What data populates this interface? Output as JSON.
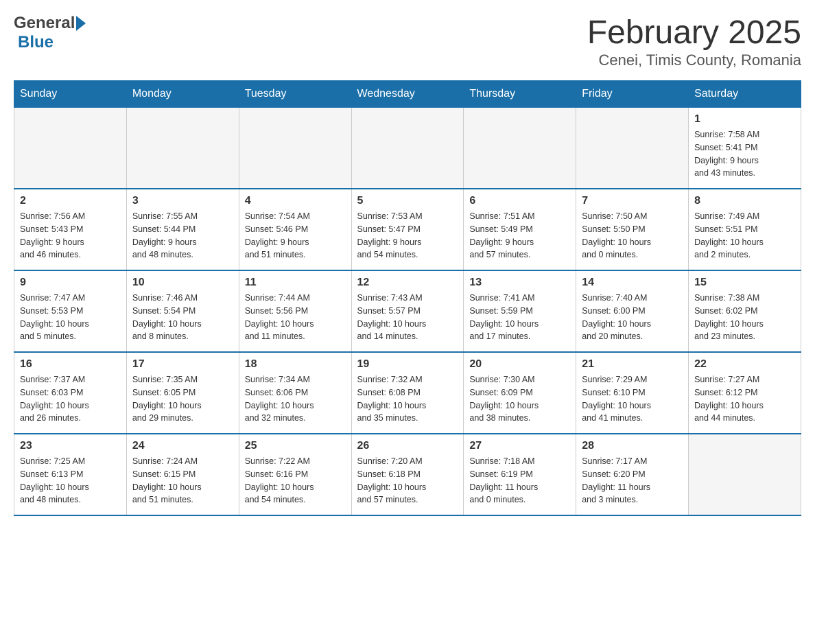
{
  "header": {
    "title": "February 2025",
    "subtitle": "Cenei, Timis County, Romania",
    "logo_general": "General",
    "logo_blue": "Blue"
  },
  "days_of_week": [
    "Sunday",
    "Monday",
    "Tuesday",
    "Wednesday",
    "Thursday",
    "Friday",
    "Saturday"
  ],
  "weeks": [
    [
      {
        "day": "",
        "info": ""
      },
      {
        "day": "",
        "info": ""
      },
      {
        "day": "",
        "info": ""
      },
      {
        "day": "",
        "info": ""
      },
      {
        "day": "",
        "info": ""
      },
      {
        "day": "",
        "info": ""
      },
      {
        "day": "1",
        "info": "Sunrise: 7:58 AM\nSunset: 5:41 PM\nDaylight: 9 hours\nand 43 minutes."
      }
    ],
    [
      {
        "day": "2",
        "info": "Sunrise: 7:56 AM\nSunset: 5:43 PM\nDaylight: 9 hours\nand 46 minutes."
      },
      {
        "day": "3",
        "info": "Sunrise: 7:55 AM\nSunset: 5:44 PM\nDaylight: 9 hours\nand 48 minutes."
      },
      {
        "day": "4",
        "info": "Sunrise: 7:54 AM\nSunset: 5:46 PM\nDaylight: 9 hours\nand 51 minutes."
      },
      {
        "day": "5",
        "info": "Sunrise: 7:53 AM\nSunset: 5:47 PM\nDaylight: 9 hours\nand 54 minutes."
      },
      {
        "day": "6",
        "info": "Sunrise: 7:51 AM\nSunset: 5:49 PM\nDaylight: 9 hours\nand 57 minutes."
      },
      {
        "day": "7",
        "info": "Sunrise: 7:50 AM\nSunset: 5:50 PM\nDaylight: 10 hours\nand 0 minutes."
      },
      {
        "day": "8",
        "info": "Sunrise: 7:49 AM\nSunset: 5:51 PM\nDaylight: 10 hours\nand 2 minutes."
      }
    ],
    [
      {
        "day": "9",
        "info": "Sunrise: 7:47 AM\nSunset: 5:53 PM\nDaylight: 10 hours\nand 5 minutes."
      },
      {
        "day": "10",
        "info": "Sunrise: 7:46 AM\nSunset: 5:54 PM\nDaylight: 10 hours\nand 8 minutes."
      },
      {
        "day": "11",
        "info": "Sunrise: 7:44 AM\nSunset: 5:56 PM\nDaylight: 10 hours\nand 11 minutes."
      },
      {
        "day": "12",
        "info": "Sunrise: 7:43 AM\nSunset: 5:57 PM\nDaylight: 10 hours\nand 14 minutes."
      },
      {
        "day": "13",
        "info": "Sunrise: 7:41 AM\nSunset: 5:59 PM\nDaylight: 10 hours\nand 17 minutes."
      },
      {
        "day": "14",
        "info": "Sunrise: 7:40 AM\nSunset: 6:00 PM\nDaylight: 10 hours\nand 20 minutes."
      },
      {
        "day": "15",
        "info": "Sunrise: 7:38 AM\nSunset: 6:02 PM\nDaylight: 10 hours\nand 23 minutes."
      }
    ],
    [
      {
        "day": "16",
        "info": "Sunrise: 7:37 AM\nSunset: 6:03 PM\nDaylight: 10 hours\nand 26 minutes."
      },
      {
        "day": "17",
        "info": "Sunrise: 7:35 AM\nSunset: 6:05 PM\nDaylight: 10 hours\nand 29 minutes."
      },
      {
        "day": "18",
        "info": "Sunrise: 7:34 AM\nSunset: 6:06 PM\nDaylight: 10 hours\nand 32 minutes."
      },
      {
        "day": "19",
        "info": "Sunrise: 7:32 AM\nSunset: 6:08 PM\nDaylight: 10 hours\nand 35 minutes."
      },
      {
        "day": "20",
        "info": "Sunrise: 7:30 AM\nSunset: 6:09 PM\nDaylight: 10 hours\nand 38 minutes."
      },
      {
        "day": "21",
        "info": "Sunrise: 7:29 AM\nSunset: 6:10 PM\nDaylight: 10 hours\nand 41 minutes."
      },
      {
        "day": "22",
        "info": "Sunrise: 7:27 AM\nSunset: 6:12 PM\nDaylight: 10 hours\nand 44 minutes."
      }
    ],
    [
      {
        "day": "23",
        "info": "Sunrise: 7:25 AM\nSunset: 6:13 PM\nDaylight: 10 hours\nand 48 minutes."
      },
      {
        "day": "24",
        "info": "Sunrise: 7:24 AM\nSunset: 6:15 PM\nDaylight: 10 hours\nand 51 minutes."
      },
      {
        "day": "25",
        "info": "Sunrise: 7:22 AM\nSunset: 6:16 PM\nDaylight: 10 hours\nand 54 minutes."
      },
      {
        "day": "26",
        "info": "Sunrise: 7:20 AM\nSunset: 6:18 PM\nDaylight: 10 hours\nand 57 minutes."
      },
      {
        "day": "27",
        "info": "Sunrise: 7:18 AM\nSunset: 6:19 PM\nDaylight: 11 hours\nand 0 minutes."
      },
      {
        "day": "28",
        "info": "Sunrise: 7:17 AM\nSunset: 6:20 PM\nDaylight: 11 hours\nand 3 minutes."
      },
      {
        "day": "",
        "info": ""
      }
    ]
  ]
}
